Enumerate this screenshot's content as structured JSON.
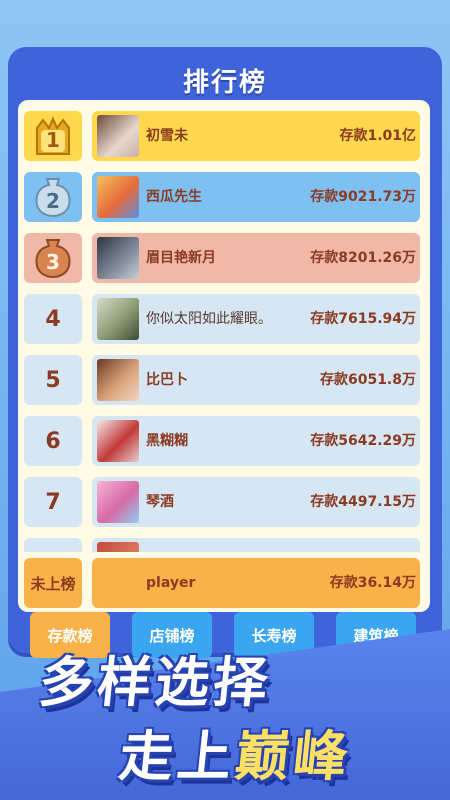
{
  "panel_title": "排行榜",
  "rows": [
    {
      "rank": "1",
      "name": "初雪未",
      "amount": "存款1.01亿"
    },
    {
      "rank": "2",
      "name": "西瓜先生",
      "amount": "存款9021.73万"
    },
    {
      "rank": "3",
      "name": "眉目艳新月",
      "amount": "存款8201.26万"
    },
    {
      "rank": "4",
      "name": "你似太阳如此耀眼。",
      "amount": "存款7615.94万"
    },
    {
      "rank": "5",
      "name": "比巴卜",
      "amount": "存款6051.8万"
    },
    {
      "rank": "6",
      "name": "黑糊糊",
      "amount": "存款5642.29万"
    },
    {
      "rank": "7",
      "name": "琴酒",
      "amount": "存款4497.15万"
    }
  ],
  "self_row": {
    "rank": "未上榜",
    "name": "player",
    "amount": "存款36.14万"
  },
  "tabs": [
    "存款榜",
    "店铺榜",
    "长寿榜",
    "建筑榜"
  ],
  "slogan": {
    "line1": "多样选择",
    "line2_prefix": "走上",
    "line2_highlight": "巅峰"
  },
  "colors": {
    "gold": "#ffd84d",
    "silver": "#7ec0f2",
    "bronze": "#f0b8a6",
    "normal": "#d6e6f2",
    "self": "#f9b24a",
    "panel": "#3f63d9"
  }
}
